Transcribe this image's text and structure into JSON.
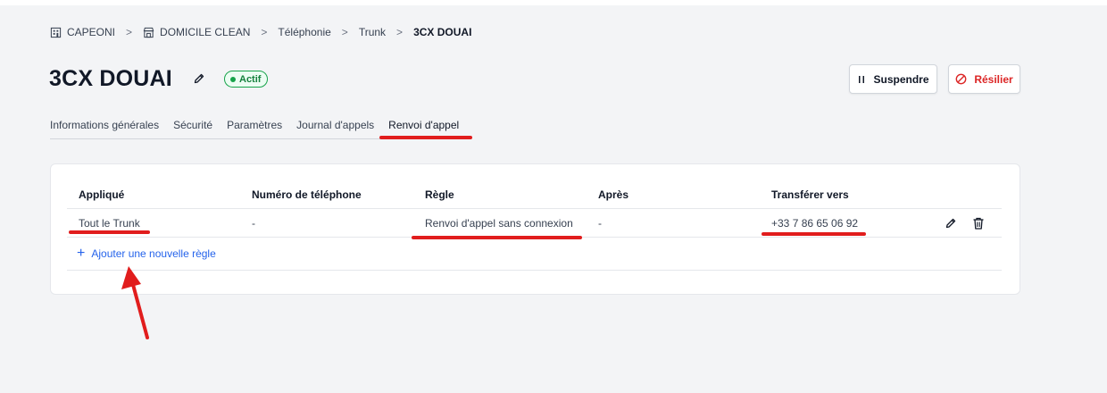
{
  "breadcrumb": {
    "items": [
      "CAPEONI",
      "DOMICILE CLEAN",
      "Téléphonie",
      "Trunk",
      "3CX DOUAI"
    ],
    "separator": ">"
  },
  "header": {
    "title": "3CX DOUAI",
    "status": "Actif",
    "suspend_label": "Suspendre",
    "cancel_label": "Résilier"
  },
  "tabs": [
    {
      "label": "Informations générales",
      "active": false
    },
    {
      "label": "Sécurité",
      "active": false
    },
    {
      "label": "Paramètres",
      "active": false
    },
    {
      "label": "Journal d'appels",
      "active": false
    },
    {
      "label": "Renvoi d'appel",
      "active": true
    }
  ],
  "table": {
    "columns": [
      "Appliqué",
      "Numéro de téléphone",
      "Règle",
      "Après",
      "Transférer vers"
    ],
    "rows": [
      {
        "applied": "Tout le Trunk",
        "phone": "-",
        "rule": "Renvoi d'appel sans connexion",
        "after": "-",
        "transfer_to": "+33 7 86 65 06 92"
      }
    ]
  },
  "add_rule_label": "Ajouter une nouvelle règle",
  "colors": {
    "status_green": "#16a34a",
    "danger_red": "#dc2626",
    "link_blue": "#2563eb",
    "annotation_red": "#e11d1d"
  }
}
